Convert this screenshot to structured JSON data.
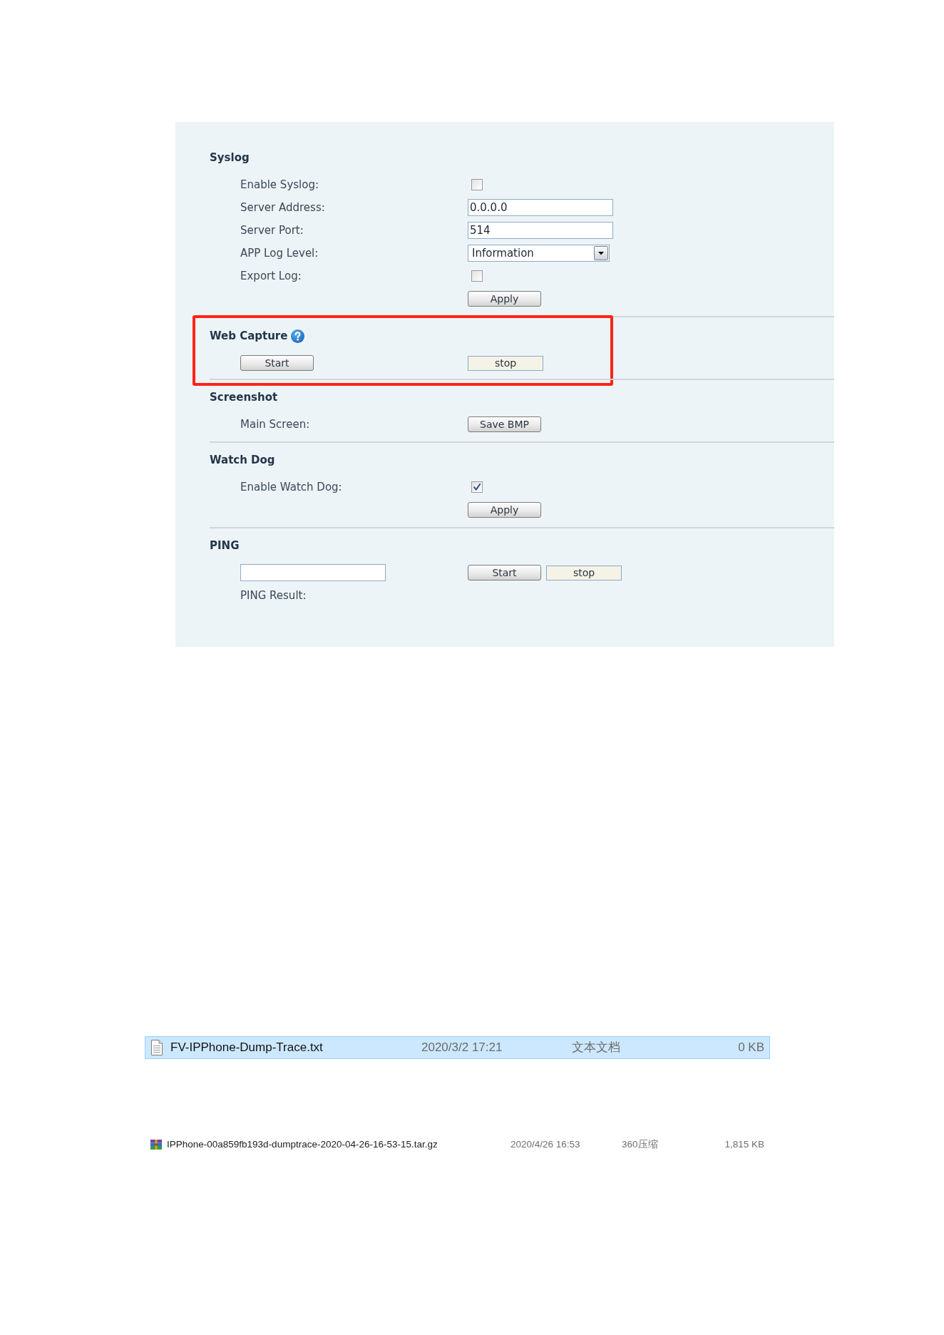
{
  "sections": [
    {
      "title": "Syslog",
      "rows": [
        {
          "label": "Enable Syslog:",
          "controls": [
            {
              "kind": "checkbox",
              "checked": false
            }
          ]
        },
        {
          "label": "Server Address:",
          "controls": [
            {
              "kind": "input",
              "value": "0.0.0.0"
            }
          ]
        },
        {
          "label": "Server Port:",
          "controls": [
            {
              "kind": "input",
              "value": "514"
            }
          ]
        },
        {
          "label": "APP Log Level:",
          "controls": [
            {
              "kind": "select",
              "value": "Information"
            }
          ]
        },
        {
          "label": "Export Log:",
          "controls": [
            {
              "kind": "checkbox",
              "checked": false
            }
          ]
        },
        {
          "controls": [
            {
              "kind": "button",
              "text": "Apply"
            }
          ]
        }
      ]
    },
    {
      "title": "Web Capture",
      "help": true,
      "highlighted": true,
      "rows": [
        {
          "lead": [
            {
              "kind": "button",
              "text": "Start"
            }
          ],
          "controls": [
            {
              "kind": "flat_button",
              "text": "stop"
            }
          ]
        }
      ]
    },
    {
      "title": "Screenshot",
      "rows": [
        {
          "label": "Main Screen:",
          "controls": [
            {
              "kind": "button",
              "text": "Save BMP"
            }
          ]
        }
      ]
    },
    {
      "title": "Watch Dog",
      "rows": [
        {
          "label": "Enable Watch Dog:",
          "controls": [
            {
              "kind": "checkbox",
              "checked": true
            }
          ]
        },
        {
          "controls": [
            {
              "kind": "button",
              "text": "Apply"
            }
          ]
        }
      ]
    },
    {
      "title": "PING",
      "rows": [
        {
          "lead": [
            {
              "kind": "input"
            }
          ],
          "controls": [
            {
              "kind": "button",
              "text": "Start"
            },
            {
              "kind": "flat_button",
              "text": "stop"
            }
          ]
        },
        {
          "label": "PING Result:"
        }
      ]
    }
  ],
  "file_listings": [
    {
      "files": [
        {
          "kind": "text",
          "name": "FV-IPPhone-Dump-Trace.txt",
          "date": "2020/3/2 17:21",
          "type": "文本文档",
          "size": "0 KB",
          "selected": true
        }
      ]
    },
    {
      "files": [
        {
          "kind": "archive",
          "name": "IPPhone-00a859fb193d-dumptrace-2020-04-26-16-53-15.tar.gz",
          "date": "2020/4/26 16:53",
          "type": "360压缩",
          "size": "1,815 KB",
          "selected": false
        }
      ]
    }
  ]
}
